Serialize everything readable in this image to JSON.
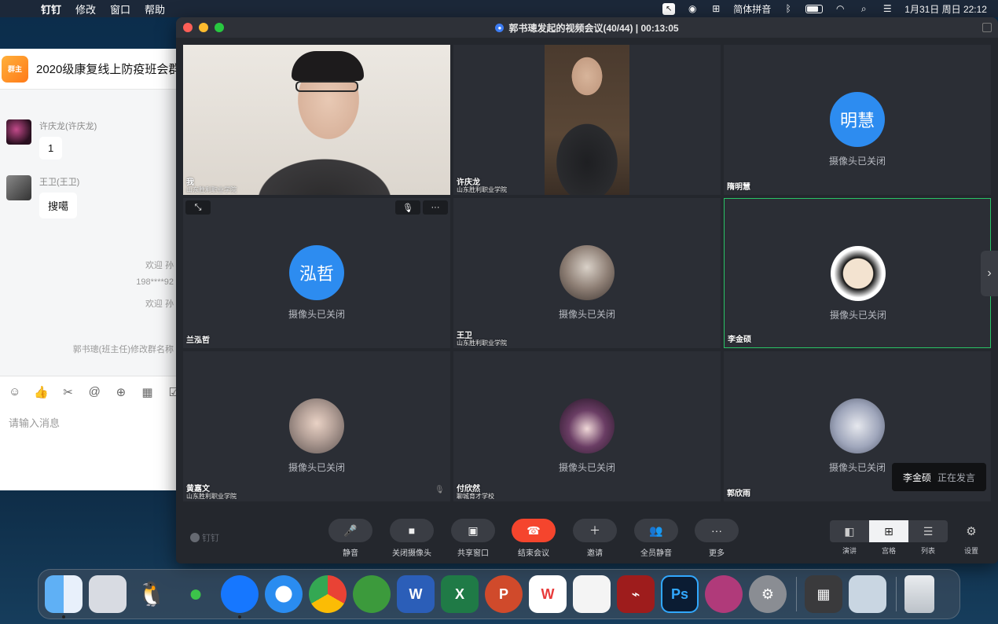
{
  "menubar": {
    "app_name": "钉钉",
    "menus": [
      "修改",
      "窗口",
      "帮助"
    ],
    "input_method": "简体拼音",
    "datetime": "1月31日 周日 22:12"
  },
  "chat": {
    "group_logo_text": "群主",
    "group_title": "2020级康复线上防疫班会群",
    "messages": [
      {
        "sender": "许庆龙(许庆龙)",
        "text": "1"
      },
      {
        "sender": "王卫(王卫)",
        "text": "搜噶"
      }
    ],
    "system_lines": [
      "欢迎 孙",
      "198****92",
      "欢迎 孙",
      "郭书璁(班主任)修改群名称"
    ],
    "input_placeholder": "请输入消息"
  },
  "meeting": {
    "title": "郭书璁发起的视频会议(40/44) | 00:13:05",
    "participants": [
      {
        "name": "我",
        "org": "山东胜利职业学院",
        "camera": "on"
      },
      {
        "name": "许庆龙",
        "org": "山东胜利职业学院",
        "camera": "on"
      },
      {
        "name": "隋明慧",
        "org": "",
        "camera": "off",
        "avatar_text": "明慧"
      },
      {
        "name": "兰泓哲",
        "org": "",
        "camera": "off",
        "avatar_text": "泓哲"
      },
      {
        "name": "王卫",
        "org": "山东胜利职业学院",
        "camera": "off"
      },
      {
        "name": "李金硕",
        "org": "",
        "camera": "off"
      },
      {
        "name": "黄嘉文",
        "org": "山东胜利职业学院",
        "camera": "off"
      },
      {
        "name": "付欣然",
        "org": "聊城育才学校",
        "camera": "off"
      },
      {
        "name": "郭欣雨",
        "org": "",
        "camera": "off"
      }
    ],
    "camera_off_text": "摄像头已关闭",
    "speaking": {
      "name": "李金硕",
      "status": "正在发言"
    },
    "brand": "钉钉",
    "controls": [
      "静音",
      "关闭摄像头",
      "共享窗口",
      "结束会议",
      "邀请",
      "全员静音",
      "更多"
    ],
    "layouts": [
      "演讲",
      "宫格",
      "列表"
    ],
    "selected_layout": "宫格",
    "settings_label": "设置",
    "end_color": "#f5452d",
    "active_speaker_color": "#29c466"
  },
  "dock": {
    "apps": [
      "finder-icon",
      "launchpad-icon",
      "qq-icon",
      "wechat-icon",
      "dingtalk-icon",
      "safari-icon",
      "chrome-icon",
      "cloud-icon",
      "word-icon",
      "excel-icon",
      "powerpoint-icon",
      "wps-icon",
      "textedit-icon",
      "acrobat-icon",
      "photoshop-icon",
      "app-icon",
      "system-preferences-icon",
      "calculator-icon",
      "preview-icon",
      "trash-icon"
    ]
  }
}
